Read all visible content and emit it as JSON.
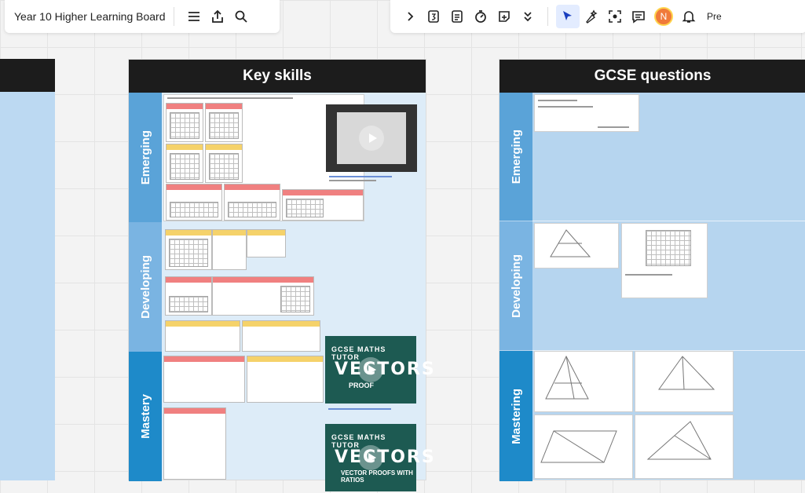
{
  "toolbar": {
    "board_title": "Year 10 Higher Learning Board",
    "avatar_initial": "N",
    "present_label": "Pre"
  },
  "frames": {
    "left_header": "",
    "key_skills": {
      "header": "Key skills",
      "rows": [
        "Emerging",
        "Developing",
        "Mastery"
      ]
    },
    "gcse": {
      "header": "GCSE questions",
      "rows": [
        "Emerging",
        "Developing",
        "Mastering"
      ]
    }
  },
  "videos": [
    {
      "tag": "GCSE MATHS TUTOR",
      "title": "VECTORS",
      "subtitle": "PROOF"
    },
    {
      "tag": "GCSE MATHS TUTOR",
      "title": "VECTORS",
      "subtitle": "VECTOR PROOFS WITH RATIOS"
    }
  ],
  "colors": {
    "emerging": "#5aa3d8",
    "developing": "#7ab4e2",
    "mastery": "#1e8ac9",
    "gcse_body": "#b6d5ef",
    "frame_header": "#1c1c1c",
    "avatar": "#f07a3a"
  }
}
